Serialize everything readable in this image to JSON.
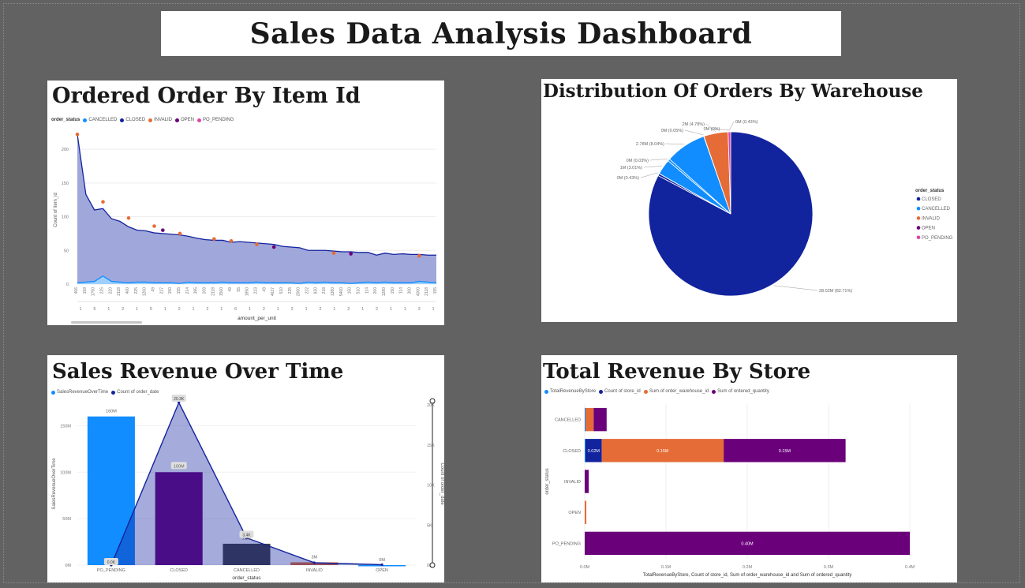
{
  "dashboard": {
    "title": "Sales Data Analysis Dashboard"
  },
  "charts": [
    {
      "title": "Ordered Order By Item Id",
      "legend_title": "order_status",
      "legend": [
        {
          "name": "CANCELLED",
          "color": "#118DFF"
        },
        {
          "name": "CLOSED",
          "color": "#12239E"
        },
        {
          "name": "INVALID",
          "color": "#E66C37"
        },
        {
          "name": "OPEN",
          "color": "#6B007B"
        },
        {
          "name": "PO_PENDING",
          "color": "#E044A7"
        }
      ],
      "ylabel": "Count of item_id",
      "xlabel": "amount_per_unit",
      "yticks": [
        "0",
        "50",
        "100",
        "150",
        "200"
      ],
      "xtick_labels": [
        "406",
        "159",
        "1750",
        "225",
        "220",
        "2118",
        "400",
        "225",
        "1200",
        "49",
        "227",
        "150",
        "155",
        "214",
        "395",
        "209",
        "2118",
        "1500",
        "49",
        "55",
        "1850",
        "223",
        "49",
        "4627",
        "510",
        "225",
        "2000",
        "222",
        "830",
        "218",
        "1380",
        "5400",
        "150",
        "510",
        "114",
        "200",
        "1280",
        "150",
        "114",
        "300",
        "4000",
        "2118",
        "155"
      ],
      "sublabels": [
        "1",
        "5",
        "1",
        "2",
        "1",
        "5",
        "1",
        "2",
        "1",
        "2",
        "1",
        "6",
        "1",
        "2",
        "1",
        "2",
        "1",
        "2",
        "1",
        "2",
        "1",
        "2",
        "1",
        "1",
        "3",
        "1"
      ]
    },
    {
      "title": "Distribution Of Orders By Warehouse",
      "legend_title": "order_status",
      "legend": [
        {
          "name": "CLOSED",
          "color": "#12239E"
        },
        {
          "name": "CANCELLED",
          "color": "#118DFF"
        },
        {
          "name": "INVALID",
          "color": "#E66C37"
        },
        {
          "name": "OPEN",
          "color": "#6B007B"
        },
        {
          "name": "PO_PENDING",
          "color": "#E044A7"
        }
      ],
      "slice_labels": [
        {
          "text": "28.02M (82.71%)"
        },
        {
          "text": "2M (4.78%)"
        },
        {
          "text": "0M (0%)"
        },
        {
          "text": "0M (0.43%)"
        },
        {
          "text": "0M (0.05%)"
        },
        {
          "text": "2.78M (8.04%)"
        },
        {
          "text": "0M (0.03%)"
        },
        {
          "text": "1M (3.01%)"
        },
        {
          "text": "0M (0.43%)"
        }
      ]
    },
    {
      "title": "Sales Revenue Over Time",
      "legend": [
        {
          "name": "SalesRevenueOverTime",
          "color": "#118DFF"
        },
        {
          "name": "Count of order_date",
          "color": "#12239E"
        }
      ],
      "ylabel": "SalesRevenueOverTime",
      "y2label": "Count of order_date",
      "xlabel": "order_status",
      "yticks": [
        "0M",
        "50M",
        "100M",
        "150M"
      ],
      "y2ticks": [
        "0K",
        "5K",
        "10K",
        "15K",
        "20K"
      ],
      "data_labels": [
        "160M",
        "100M",
        "23M",
        "3M",
        "0M",
        "0.0K",
        "20.3K",
        "3.4K"
      ]
    },
    {
      "title": "Total Revenue By Store",
      "legend": [
        {
          "name": "TotalRevenueByStore",
          "color": "#118DFF"
        },
        {
          "name": "Count of store_id",
          "color": "#12239E"
        },
        {
          "name": "Sum of order_warehouse_id",
          "color": "#E66C37"
        },
        {
          "name": "Sum of ordered_quantity",
          "color": "#6B007B"
        }
      ],
      "ylabel": "order_status",
      "xlabel": "TotalRevenueByStore, Count of store_id, Sum of order_warehouse_id and Sum of ordered_quantity",
      "xticks": [
        "0.0M",
        "0.1M",
        "0.2M",
        "0.3M",
        "0.4M"
      ],
      "data_labels": [
        "0.02M",
        "0.15M",
        "0.15M",
        "0.40M"
      ]
    }
  ],
  "chart_data": [
    {
      "type": "area",
      "title": "Ordered Order By Item Id",
      "xlabel": "amount_per_unit",
      "ylabel": "Count of item_id",
      "ylim": [
        0,
        220
      ],
      "categories": [
        "406",
        "159",
        "1750",
        "225",
        "220",
        "2118",
        "400",
        "225",
        "1200",
        "49",
        "227",
        "150",
        "155",
        "214",
        "395",
        "209",
        "2118",
        "1500",
        "49",
        "55",
        "1850",
        "223",
        "49",
        "4627",
        "510",
        "225",
        "2000",
        "222",
        "830",
        "218",
        "1380",
        "5400",
        "150",
        "510",
        "114",
        "200",
        "1280",
        "150",
        "114",
        "300",
        "4000",
        "2118",
        "155"
      ],
      "series": [
        {
          "name": "CLOSED",
          "values": [
            222,
            133,
            110,
            112,
            97,
            93,
            85,
            80,
            79,
            76,
            75,
            74,
            73,
            71,
            68,
            66,
            65,
            65,
            62,
            63,
            62,
            61,
            60,
            59,
            56,
            55,
            54,
            50,
            50,
            50,
            49,
            48,
            48,
            47,
            47,
            43,
            46,
            44,
            45,
            44,
            44,
            43,
            43
          ]
        },
        {
          "name": "CANCELLED",
          "values": [
            2,
            3,
            4,
            12,
            4,
            3,
            2,
            3,
            3,
            2,
            2,
            2,
            1,
            3,
            2,
            2,
            2,
            3,
            2,
            2,
            2,
            3,
            2,
            2,
            2,
            2,
            1,
            3,
            2,
            3,
            2,
            2,
            1,
            2,
            3,
            2,
            3,
            2,
            2,
            2,
            4,
            3,
            2
          ]
        }
      ],
      "markers": [
        {
          "series": "INVALID",
          "x": "406",
          "y": 222
        },
        {
          "series": "INVALID",
          "x": "225",
          "y": 122
        },
        {
          "series": "INVALID",
          "x": "400",
          "y": 98
        },
        {
          "series": "INVALID",
          "x": "49",
          "y": 86
        },
        {
          "series": "OPEN",
          "x": "227",
          "y": 80
        },
        {
          "series": "INVALID",
          "x": "155",
          "y": 75
        },
        {
          "series": "INVALID",
          "x": "2118",
          "y": 67
        },
        {
          "series": "INVALID",
          "x": "49",
          "y": 64
        },
        {
          "series": "INVALID",
          "x": "223",
          "y": 59
        },
        {
          "series": "OPEN",
          "x": "4627",
          "y": 55
        },
        {
          "series": "INVALID",
          "x": "1380",
          "y": 46
        },
        {
          "series": "OPEN",
          "x": "150",
          "y": 45
        },
        {
          "series": "INVALID",
          "x": "4000",
          "y": 42
        }
      ],
      "legend": "top-left"
    },
    {
      "type": "pie",
      "title": "Distribution Of Orders By Warehouse",
      "slices": [
        {
          "label": "CLOSED",
          "value": 82.71,
          "color": "#12239E"
        },
        {
          "label": "CANCELLED",
          "value": 0.43,
          "color": "#12239E"
        },
        {
          "label": "CANCELLED",
          "value": 0.03,
          "color": "#118DFF"
        },
        {
          "label": "CANCELLED",
          "value": 3.01,
          "color": "#118DFF"
        },
        {
          "label": "CANCELLED",
          "value": 0.43,
          "color": "#118DFF"
        },
        {
          "label": "CANCELLED",
          "value": 8.04,
          "color": "#118DFF"
        },
        {
          "label": "INVALID",
          "value": 0.05,
          "color": "#E66C37"
        },
        {
          "label": "INVALID",
          "value": 4.78,
          "color": "#E66C37"
        },
        {
          "label": "PO_PENDING",
          "value": 0.5,
          "color": "#E044A7"
        }
      ],
      "legend": "right"
    },
    {
      "type": "bar",
      "title": "Sales Revenue Over Time",
      "categories": [
        "PO_PENDING",
        "CLOSED",
        "CANCELLED",
        "INVALID",
        "OPEN"
      ],
      "series": [
        {
          "name": "SalesRevenueOverTime",
          "values": [
            160,
            100,
            23,
            3,
            0
          ],
          "unit": "M"
        },
        {
          "name": "Count of order_date",
          "values": [
            0.0,
            20.3,
            3.4,
            0.3,
            0.05
          ],
          "unit": "K",
          "type": "area",
          "axis": "right"
        }
      ],
      "bar_colors": [
        "#118DFF",
        "#6B007B",
        "#404040",
        "#E66C37",
        "#118DFF"
      ],
      "ylim": [
        0,
        175
      ],
      "y2lim": [
        0,
        20.3
      ],
      "xlabel": "order_status",
      "ylabel": "SalesRevenueOverTime",
      "y2label": "Count of order_date",
      "legend": "top-left"
    },
    {
      "type": "bar",
      "orientation": "horizontal",
      "stacked": true,
      "title": "Total Revenue By Store",
      "categories": [
        "CANCELLED",
        "CLOSED",
        "INVALID",
        "OPEN",
        "PO_PENDING"
      ],
      "series": [
        {
          "name": "TotalRevenueByStore",
          "values": [
            0.001,
            0.001,
            0,
            0,
            0
          ]
        },
        {
          "name": "Count of store_id",
          "values": [
            0,
            0.02,
            0,
            0,
            0
          ]
        },
        {
          "name": "Sum of order_warehouse_id",
          "values": [
            0.01,
            0.15,
            0,
            0.002,
            0
          ]
        },
        {
          "name": "Sum of ordered_quantity",
          "values": [
            0.016,
            0.15,
            0.005,
            0,
            0.4
          ]
        }
      ],
      "xlim": [
        0,
        0.4
      ],
      "xlabel": "TotalRevenueByStore, Count of store_id, Sum of order_warehouse_id and Sum of ordered_quantity",
      "ylabel": "order_status",
      "legend": "top-left"
    }
  ]
}
